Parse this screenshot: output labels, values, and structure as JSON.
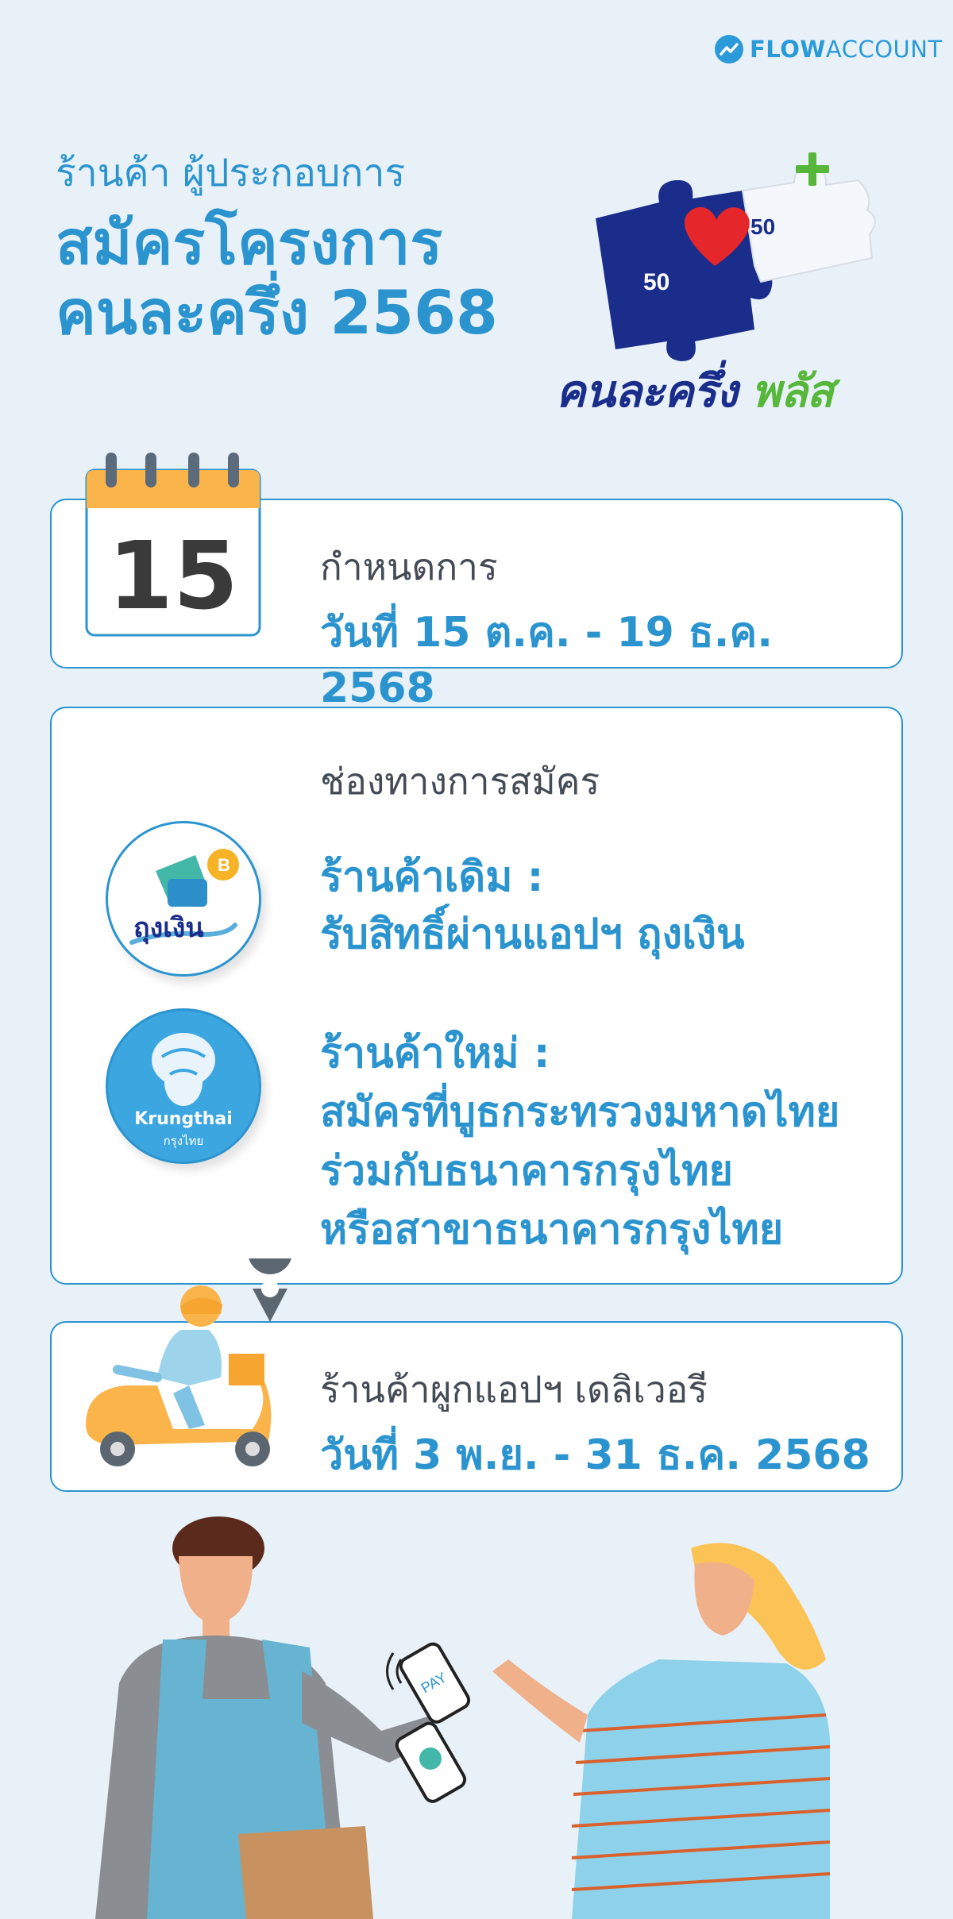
{
  "brand": {
    "name_bold": "FLOW",
    "name_rest": "ACCOUNT"
  },
  "header": {
    "kicker": "ร้านค้า ผู้ประกอบการ",
    "title_line1": "สมัครโครงการ",
    "title_line2": "คนละครึ่ง 2568"
  },
  "promo": {
    "badge_left": "50",
    "badge_right": "50",
    "name": "คนละครึ่ง",
    "name_plus": "พลัส"
  },
  "schedule": {
    "day": "15",
    "label": "กำหนดการ",
    "dates": "วันที่ 15 ต.ค. - 19 ธ.ค. 2568"
  },
  "channels": {
    "title": "ช่องทางการสมัคร",
    "existing_title": "ร้านค้าเดิม :",
    "existing_detail": "รับสิทธิ์ผ่านแอปฯ ถุงเงิน",
    "tungngern_logo_text": "ถุงเงิน",
    "new_title": "ร้านค้าใหม่ :",
    "new_line1": "สมัครที่บูธกระทรวงมหาดไทย",
    "new_line2": "ร่วมกับธนาคารกรุงไทย",
    "new_line3": "หรือสาขาธนาคารกรุงไทย",
    "krungthai_en": "Krungthai",
    "krungthai_th": "กรุงไทย"
  },
  "delivery": {
    "label": "ร้านค้าผูกแอปฯ เดลิเวอรี",
    "dates": "วันที่ 3 พ.ย. - 31 ธ.ค. 2568"
  },
  "illustration": {
    "phone_text": "PAY"
  },
  "colors": {
    "background": "#e8f1f8",
    "accent": "#2b94cf",
    "navy": "#1a2d8a",
    "green": "#57b73a",
    "heart": "#e5262a"
  }
}
